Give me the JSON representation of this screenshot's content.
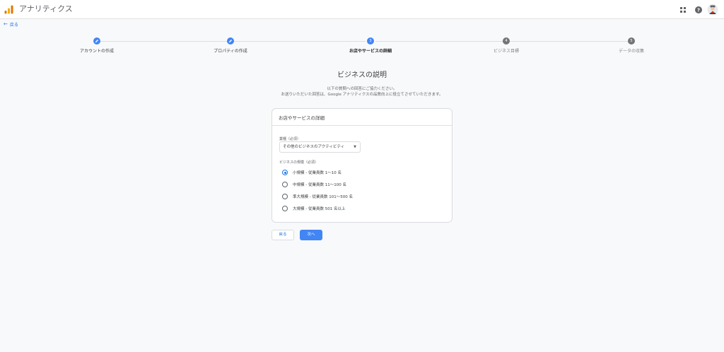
{
  "app": {
    "title": "アナリティクス"
  },
  "nav": {
    "back_link": "戻る"
  },
  "steps": [
    {
      "number": "",
      "label": "アカウントの作成",
      "state": "done"
    },
    {
      "number": "",
      "label": "プロパティの作成",
      "state": "done"
    },
    {
      "number": "3",
      "label": "お店やサービスの詳細",
      "state": "active"
    },
    {
      "number": "4",
      "label": "ビジネス目標",
      "state": "pending"
    },
    {
      "number": "5",
      "label": "データの収集",
      "state": "pending"
    }
  ],
  "page": {
    "heading": "ビジネスの説明",
    "desc_line1": "以下の質問への回答にご協力ください。",
    "desc_line2": "お送りいただいた回答は、Google アナリティクスの品質向上に役立てさせていただきます。"
  },
  "card": {
    "title": "お店やサービスの詳細",
    "industry_label": "業種（必須）",
    "industry_value": "その他のビジネスのアクティビティ",
    "size_label": "ビジネスの規模（必須）",
    "size_options": [
      {
        "label": "小規模 - 従業員数 1〜10 名",
        "checked": true
      },
      {
        "label": "中規模 - 従業員数 11〜100 名",
        "checked": false
      },
      {
        "label": "準大規模 - 従業員数 101〜500 名",
        "checked": false
      },
      {
        "label": "大規模 - 従業員数 501 名以上",
        "checked": false
      }
    ]
  },
  "buttons": {
    "back": "戻る",
    "next": "次へ"
  },
  "colors": {
    "accent": "#1a73e8",
    "step_active": "#4285f4",
    "step_pending": "#757575",
    "background": "#f8f9fa"
  }
}
